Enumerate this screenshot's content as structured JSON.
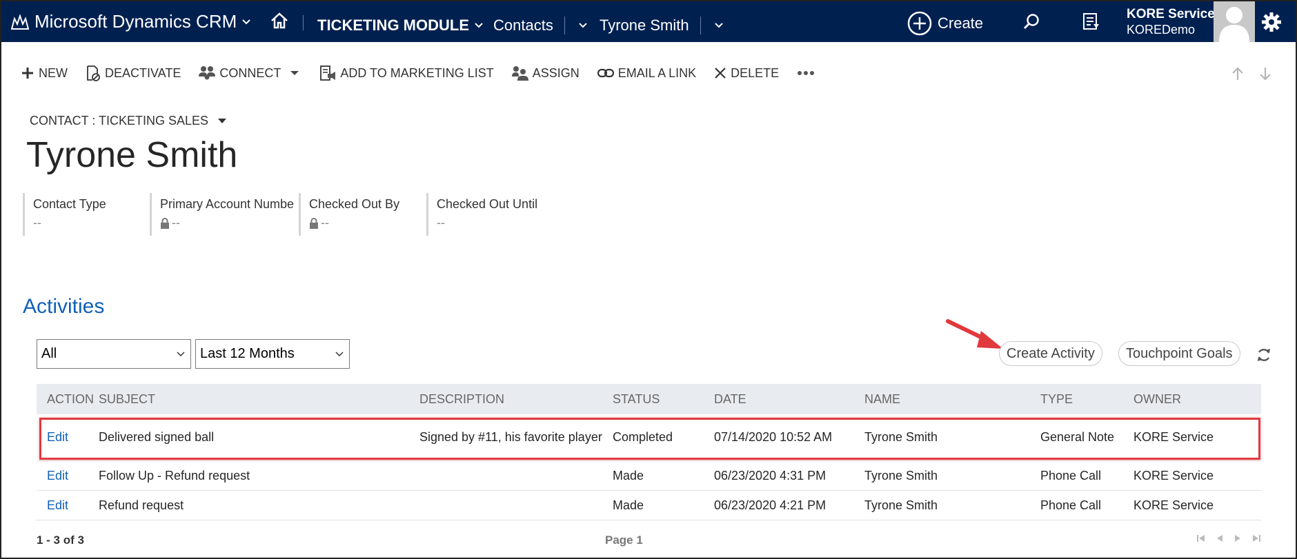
{
  "topnav": {
    "brand": "Microsoft Dynamics CRM",
    "module": "TICKETING MODULE",
    "entity": "Contacts",
    "record": "Tyrone Smith",
    "create_label": "Create",
    "user_name": "KORE Service",
    "user_org": "KOREDemo",
    "icons": [
      "dynamics-logo-icon",
      "home-icon",
      "plus-circle-icon",
      "search-icon",
      "advanced-find-icon",
      "gear-icon"
    ]
  },
  "commandbar": {
    "new": "NEW",
    "deactivate": "DEACTIVATE",
    "connect": "CONNECT",
    "add_to_marketing_list": "ADD TO MARKETING LIST",
    "assign": "ASSIGN",
    "email_a_link": "EMAIL A LINK",
    "delete": "DELETE"
  },
  "header": {
    "form_selector": "CONTACT : TICKETING SALES",
    "title": "Tyrone Smith",
    "fields": [
      {
        "label": "Contact Type",
        "value": "--",
        "locked": false
      },
      {
        "label": "Primary Account Numbe",
        "value": "--",
        "locked": true
      },
      {
        "label": "Checked Out By",
        "value": "--",
        "locked": true
      },
      {
        "label": "Checked Out Until",
        "value": "--",
        "locked": false
      }
    ]
  },
  "activities": {
    "title": "Activities",
    "filter_type": "All",
    "filter_period": "Last 12 Months",
    "create_activity": "Create Activity",
    "touchpoint_goals": "Touchpoint Goals",
    "columns": [
      "ACTION",
      "SUBJECT",
      "DESCRIPTION",
      "STATUS",
      "DATE",
      "NAME",
      "TYPE",
      "OWNER"
    ],
    "rows": [
      {
        "action": "Edit",
        "subject": "Delivered signed ball",
        "description": "Signed by #11, his favorite player",
        "status": "Completed",
        "date": "07/14/2020 10:52 AM",
        "name": "Tyrone Smith",
        "type": "General Note",
        "owner": "KORE Service"
      },
      {
        "action": "Edit",
        "subject": "Follow Up - Refund request",
        "description": "",
        "status": "Made",
        "date": "06/23/2020 4:31 PM",
        "name": "Tyrone Smith",
        "type": "Phone Call",
        "owner": "KORE Service"
      },
      {
        "action": "Edit",
        "subject": "Refund request",
        "description": "",
        "status": "Made",
        "date": "06/23/2020 4:21 PM",
        "name": "Tyrone Smith",
        "type": "Phone Call",
        "owner": "KORE Service"
      }
    ],
    "record_count": "1 - 3 of 3",
    "page": "Page 1"
  },
  "colors": {
    "nav_bg": "#002050",
    "link": "#1160b7",
    "highlight": "#e0393e"
  }
}
